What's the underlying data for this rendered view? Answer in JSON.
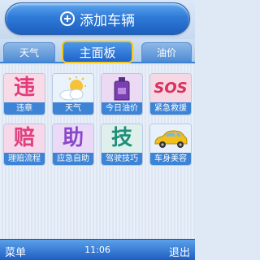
{
  "header": {
    "add_button_label": "添加车辆"
  },
  "tabs": [
    {
      "label": "天气"
    },
    {
      "label": "主面板"
    },
    {
      "label": "油价"
    }
  ],
  "grid": {
    "items": [
      {
        "label": "违章",
        "icon_char": "违",
        "icon": "violation-char-icon",
        "color": "#e23a7a"
      },
      {
        "label": "天气",
        "icon": "sun-cloud-icon"
      },
      {
        "label": "今日油价",
        "icon": "oil-bottle-icon"
      },
      {
        "label": "紧急救援",
        "icon_char": "SOS",
        "icon": "sos-icon",
        "color": "#d9305f"
      },
      {
        "label": "理赔流程",
        "icon_char": "赔",
        "icon": "claims-char-icon",
        "color": "#e0407e"
      },
      {
        "label": "应急自助",
        "icon_char": "助",
        "icon": "help-char-icon",
        "color": "#8a48c8"
      },
      {
        "label": "驾驶技巧",
        "icon_char": "技",
        "icon": "tips-char-icon",
        "color": "#1f8f7a"
      },
      {
        "label": "车身美容",
        "icon": "car-icon"
      }
    ]
  },
  "softkeys": {
    "left": "菜单",
    "time": "11:06",
    "right": "退出"
  }
}
